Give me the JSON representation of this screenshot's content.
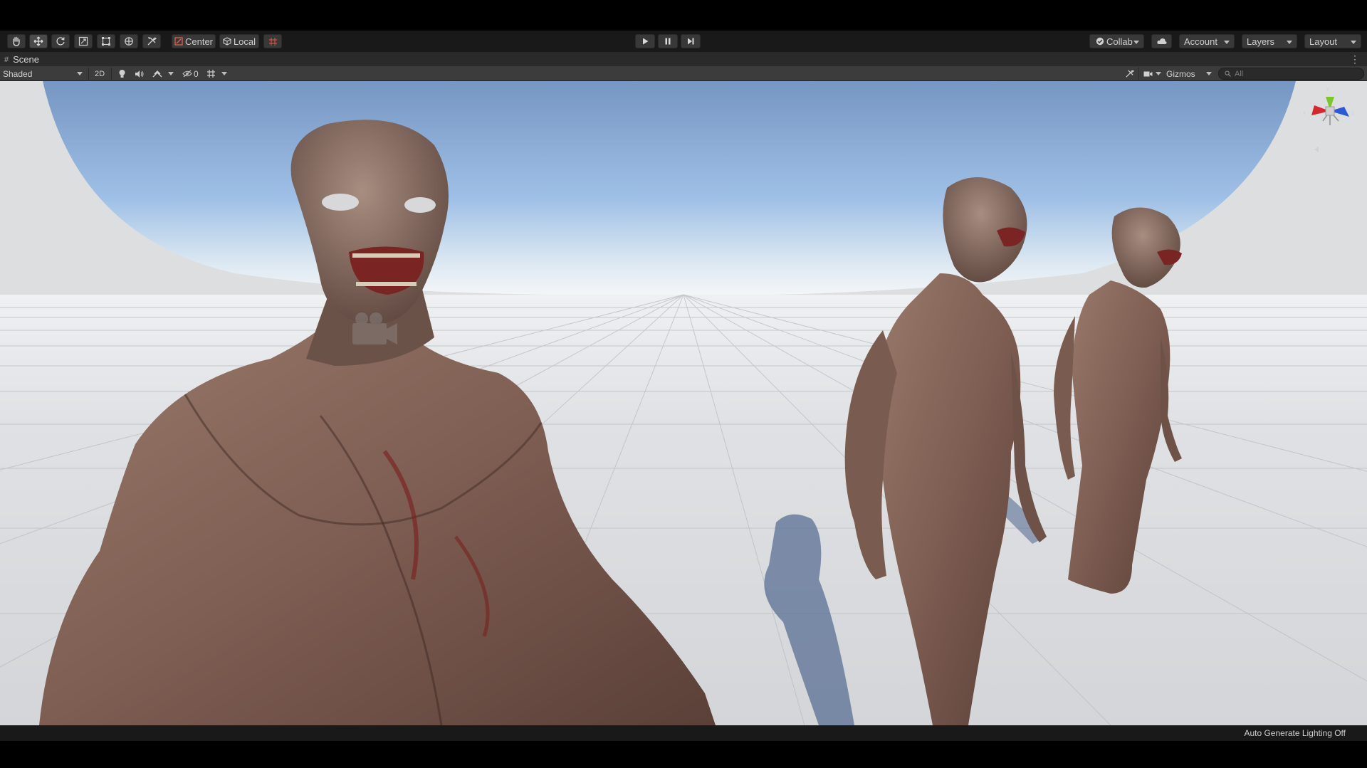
{
  "toolbar": {
    "tools": [
      {
        "name": "hand-tool",
        "icon": "hand-icon"
      },
      {
        "name": "move-tool",
        "icon": "move-icon",
        "active": true
      },
      {
        "name": "rotate-tool",
        "icon": "rotate-icon"
      },
      {
        "name": "scale-tool",
        "icon": "scale-icon"
      },
      {
        "name": "rect-tool",
        "icon": "rect-icon"
      },
      {
        "name": "transform-tool",
        "icon": "transform-icon"
      },
      {
        "name": "custom-tool",
        "icon": "tools-icon"
      }
    ],
    "pivot_mode": "Center",
    "pivot_rotation": "Local",
    "play": {
      "play_icon": "play-icon",
      "pause_icon": "pause-icon",
      "step_icon": "step-icon"
    },
    "collab_label": "Collab",
    "account_label": "Account",
    "layers_label": "Layers",
    "layout_label": "Layout",
    "cloud_icon": "cloud-icon"
  },
  "scene_tab": {
    "label": "Scene",
    "icon": "hash-icon"
  },
  "scene_toolbar": {
    "draw_mode": "Shaded",
    "mode_2d": "2D",
    "hidden_count": "0",
    "gizmos_label": "Gizmos",
    "search_placeholder": "All"
  },
  "gizmo": {
    "axis_x": "x",
    "axis_y": "y",
    "axis_z": "z"
  },
  "status": {
    "lighting": "Auto Generate Lighting Off"
  },
  "colors": {
    "toolbar_bg": "#191919",
    "scene_toolbar_bg": "#3c3c3c",
    "sky_top": "#7a9cc8",
    "horizon": "#f2f4f6",
    "ground": "#d9dadc",
    "axis_x": "#d8262b",
    "axis_y": "#7cc628",
    "axis_z": "#2a5ad8"
  }
}
